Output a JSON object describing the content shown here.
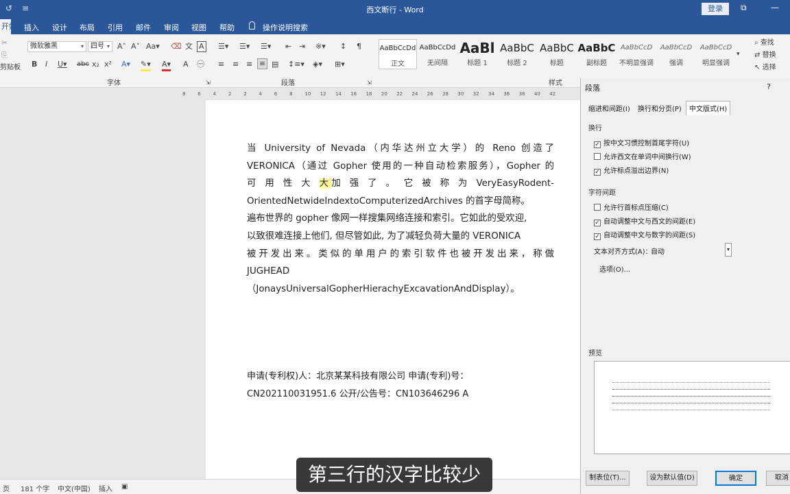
{
  "window": {
    "title": "西文断行 - Word",
    "login_label": "登录",
    "qa_icons": [
      "refresh-icon",
      "customize-icon"
    ],
    "win_icons": [
      "ribbon-display-icon",
      "minimize-icon"
    ]
  },
  "tabs": [
    {
      "label": "开始",
      "active": true
    },
    {
      "label": "插入"
    },
    {
      "label": "设计"
    },
    {
      "label": "布局"
    },
    {
      "label": "引用"
    },
    {
      "label": "邮件"
    },
    {
      "label": "审阅"
    },
    {
      "label": "视图"
    },
    {
      "label": "帮助"
    }
  ],
  "tell_me": "操作说明搜索",
  "ribbon": {
    "clipboard_label": "剪贴板",
    "font_name": "微软雅黑",
    "font_size": "四号",
    "font_group": "字体",
    "para_group": "段落",
    "styles_group": "样式",
    "styles": [
      {
        "preview": "AaBbCcDd",
        "label": "正文",
        "selected": true,
        "size": 10
      },
      {
        "preview": "AaBbCcDd",
        "label": "无间隔",
        "size": 10
      },
      {
        "preview": "AaBl",
        "label": "标题 1",
        "size": 20,
        "bold": true
      },
      {
        "preview": "AaBbC",
        "label": "标题 2",
        "size": 15
      },
      {
        "preview": "AaBbC",
        "label": "标题",
        "size": 15
      },
      {
        "preview": "AaBbC",
        "label": "副标题",
        "size": 15,
        "bold": true
      },
      {
        "preview": "AaBbCcD",
        "label": "不明显强调",
        "size": 10,
        "italic": true
      },
      {
        "preview": "AaBbCcD",
        "label": "强调",
        "size": 10,
        "italic": true
      },
      {
        "preview": "AaBbCcD",
        "label": "明显强调",
        "size": 10,
        "italic": true
      }
    ],
    "find_label": "查找",
    "replace_label": "替换",
    "select_label": "选择"
  },
  "ruler_numbers": [
    "8",
    "6",
    "4",
    "2",
    "2",
    "4",
    "6",
    "8",
    "10",
    "12",
    "14",
    "16",
    "18",
    "20",
    "22",
    "24",
    "26",
    "28",
    "30",
    "32",
    "34",
    "36",
    "38",
    "40",
    "42"
  ],
  "document": {
    "lines": [
      {
        "text": "当 University of Nevada（内华达州立大学）的 Reno 创造了",
        "justify": true
      },
      {
        "text": "VERONICA（通过 Gopher 使用的一种自动检索服务），Gopher 的",
        "justify": true
      },
      {
        "pre": "可 用 性 大 ",
        "hl": "大",
        "post": "加 强 了 。 它 被 称 为  VeryEasyRodent-",
        "justify": true
      },
      {
        "text": "OrientedNetwideIndextoComputerizedArchives 的首字母简称。",
        "justify": false
      },
      {
        "text": "遍布世界的 gopher 像网一样搜集网络连接和索引。它如此的受欢迎,",
        "justify": false
      },
      {
        "text": "以致很难连接上他们, 但尽管如此, 为了减轻负荷大量的 VERONICA",
        "justify": false
      },
      {
        "text": "被开发出来。类似的单用户的索引软件也被开发出来，称做",
        "justify": true
      },
      {
        "text": "JUGHEAD",
        "justify": false
      },
      {
        "text": "（JonaysUniversalGopherHierachyExcavationAndDisplay）。",
        "justify": false
      }
    ],
    "meta_line1": "申请(专利权)人：北京某某科技有限公司  申请(专利)号：",
    "meta_line2": "CN202110031951.6  公开/公告号：CN103646296 A"
  },
  "status": {
    "page": "页",
    "words": "181 个字",
    "lang": "中文(中国)",
    "mode": "插入"
  },
  "subtitle": "第三行的汉字比较少",
  "dialog": {
    "title": "段落",
    "help": "?",
    "tabs": [
      "缩进和间距(I)",
      "换行和分页(P)",
      "中文版式(H)"
    ],
    "section_wrap": "换行",
    "wrap_options": [
      {
        "label": "按中文习惯控制首尾字符(U)",
        "checked": true
      },
      {
        "label": "允许西文在单词中间换行(W)",
        "checked": false
      },
      {
        "label": "允许标点溢出边界(N)",
        "checked": true
      }
    ],
    "section_spacing": "字符间距",
    "spacing_options": [
      {
        "label": "允许行首标点压缩(C)",
        "checked": false
      },
      {
        "label": "自动调整中文与西文的间距(E)",
        "checked": true
      },
      {
        "label": "自动调整中文与数字的间距(S)",
        "checked": true
      }
    ],
    "align_label": "文本对齐方式(A)：",
    "align_value": "自动",
    "options_button": "选项(O)...",
    "preview_label": "预览",
    "tabs_button": "制表位(T)...",
    "default_button": "设为默认值(D)",
    "ok_button": "确定",
    "cancel_button": "取消"
  }
}
